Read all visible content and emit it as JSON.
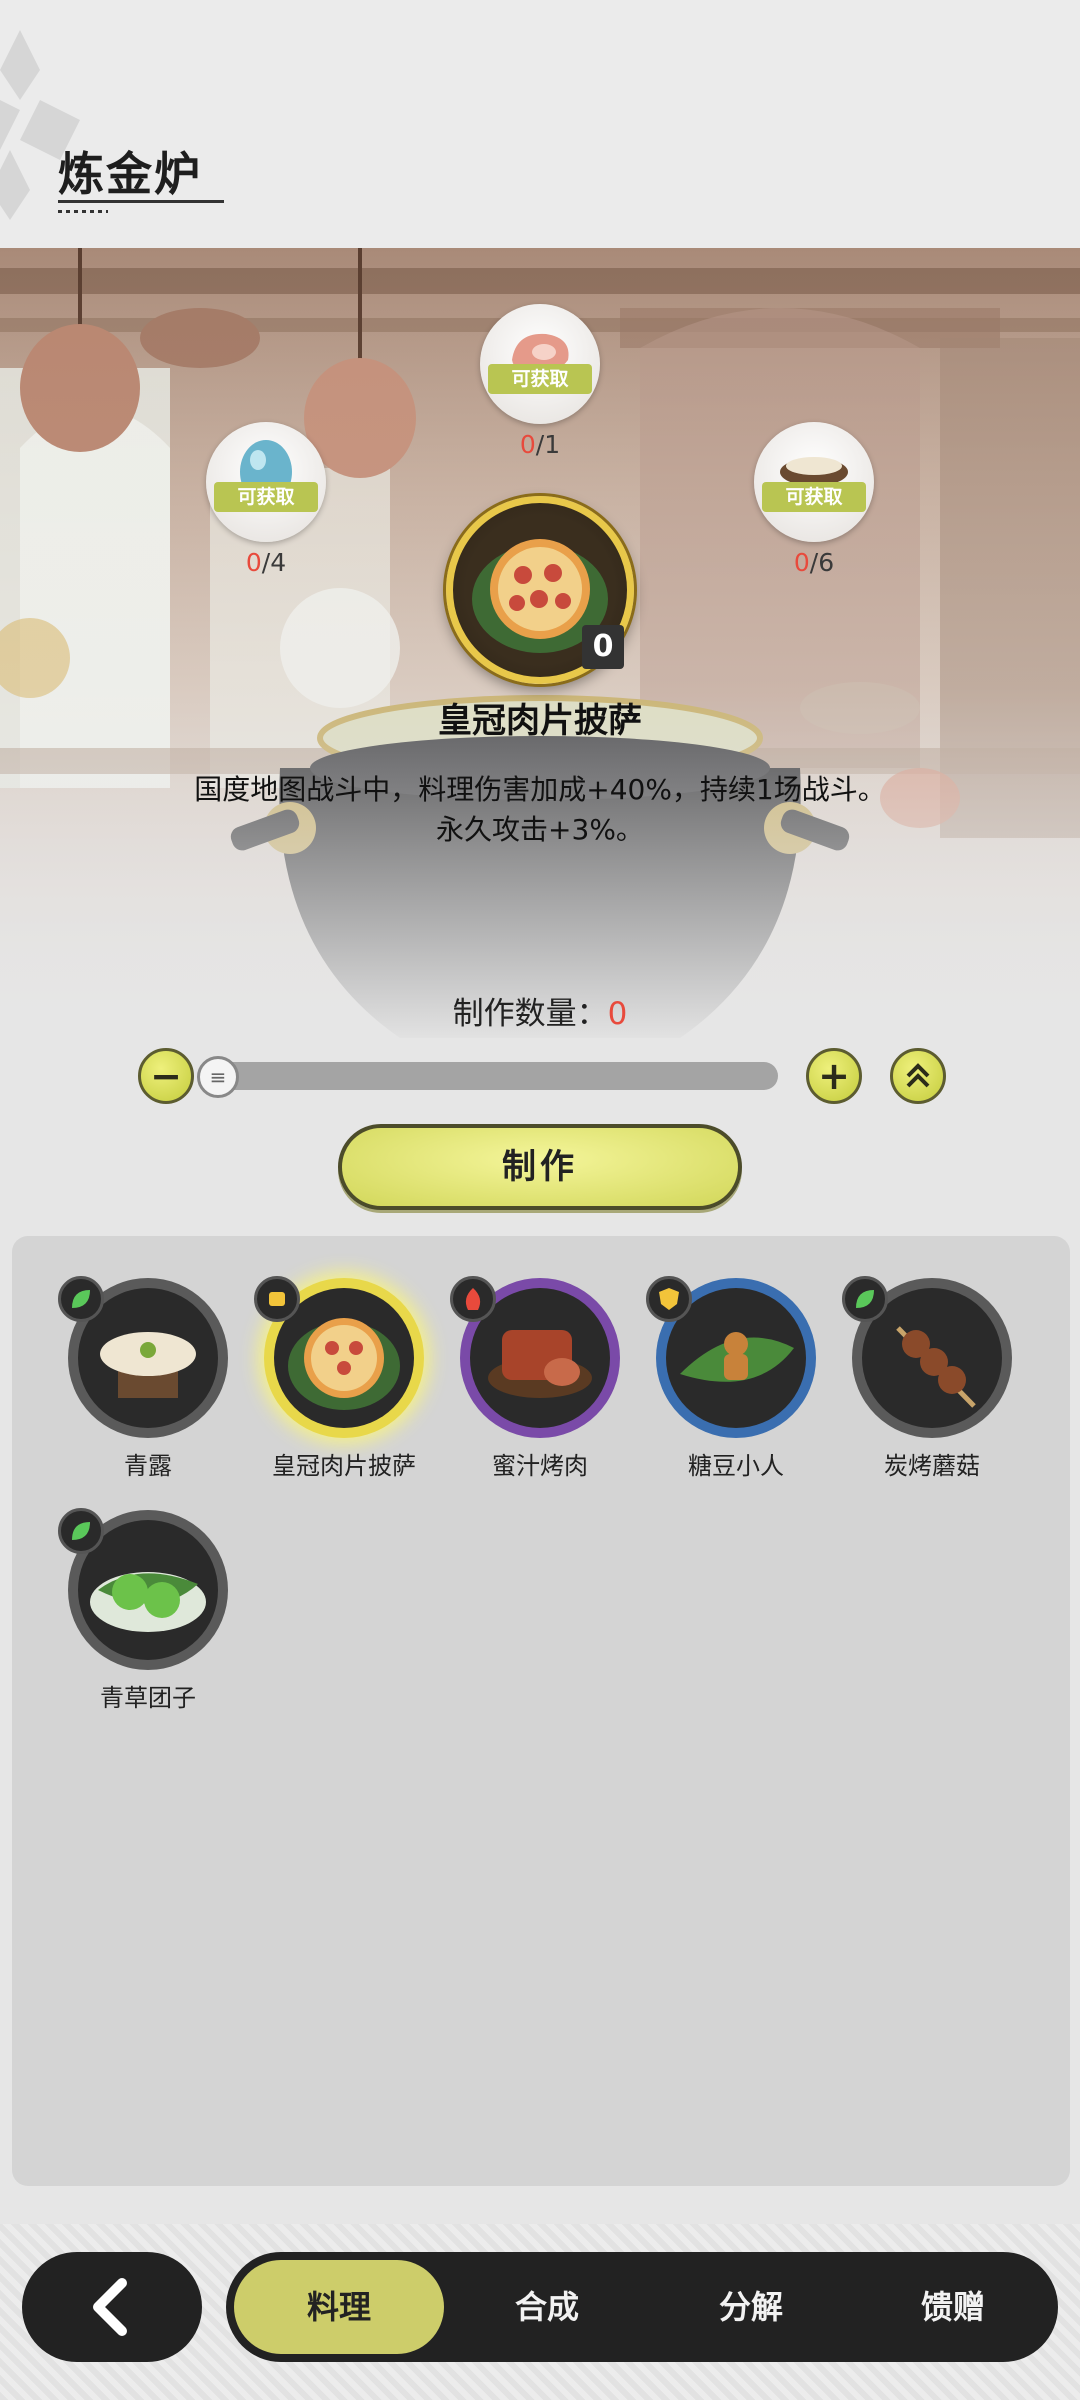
{
  "header": {
    "title": "炼金炉"
  },
  "ingredients": [
    {
      "tag": "可获取",
      "have": "0",
      "need": "/4",
      "icon": "blue-egg-icon"
    },
    {
      "tag": "可获取",
      "have": "0",
      "need": "/1",
      "icon": "meat-icon"
    },
    {
      "tag": "可获取",
      "have": "0",
      "need": "/6",
      "icon": "grain-bowl-icon"
    }
  ],
  "dish": {
    "name": "皇冠肉片披萨",
    "qty": "0",
    "desc_line1": "国度地图战斗中，料理伤害加成+40%，持续1场战斗。",
    "desc_line2": "永久攻击+3%。",
    "icon": "pizza-icon"
  },
  "craft": {
    "count_label": "制作数量：",
    "count_value": "0",
    "make_label": "制作"
  },
  "slider": {
    "value": 0
  },
  "recipes": [
    {
      "label": "青露",
      "badge": "leaf-badge-icon",
      "tier": "gray",
      "icon": "porridge-icon"
    },
    {
      "label": "皇冠肉片披萨",
      "badge": "fist-badge-icon",
      "tier": "gold",
      "icon": "pizza-icon"
    },
    {
      "label": "蜜汁烤肉",
      "badge": "flame-badge-icon",
      "tier": "purple",
      "icon": "roast-meat-icon"
    },
    {
      "label": "糖豆小人",
      "badge": "shield-badge-icon",
      "tier": "blue",
      "icon": "gingerbread-icon"
    },
    {
      "label": "炭烤蘑菇",
      "badge": "leaf-badge-icon",
      "tier": "gray",
      "icon": "mushroom-skewer-icon"
    },
    {
      "label": "青草团子",
      "badge": "leaf-badge-icon",
      "tier": "gray",
      "icon": "green-dumpling-icon"
    }
  ],
  "tabs": [
    {
      "label": "料理",
      "active": true
    },
    {
      "label": "合成",
      "active": false
    },
    {
      "label": "分解",
      "active": false
    },
    {
      "label": "馈赠",
      "active": false
    }
  ],
  "colors": {
    "accent": "#cdcd6a",
    "warning": "#e84a3c",
    "tag": "#b9c552"
  }
}
